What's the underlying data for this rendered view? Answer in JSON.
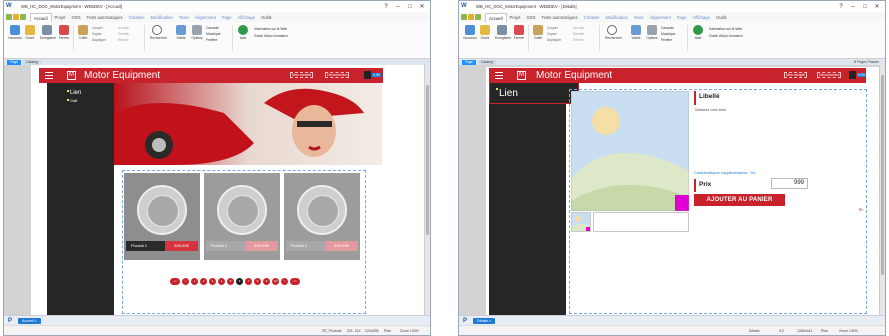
{
  "windowA": {
    "title": "WB_HC_DOC_MotorEquipment - WEBDEV - [Accueil]",
    "controls": [
      "?",
      "–",
      "□",
      "✕"
    ],
    "menu_tabs": [
      "Accueil",
      "Projet",
      "GDS",
      "Tests automatiques",
      "Création",
      "Modification",
      "Texte",
      "Alignement",
      "Page",
      "Affichage",
      "Outils"
    ],
    "ribbon": {
      "buttons": [
        "Nouveau",
        "Ouvrir",
        "Enregistrer",
        "Fermer",
        "Coller",
        "Rechercher",
        "Volets",
        "Options",
        "Aide"
      ],
      "clipboard": [
        "Couper",
        "Copier",
        "Dupliquer"
      ],
      "undo": [
        "Annuler",
        "Rétablir",
        "Refaire"
      ],
      "windows": [
        "Cascade",
        "Mosaïque",
        "Fenêtre"
      ],
      "help": [
        "Information sur le Web",
        "Guide d'Auto-formation"
      ],
      "groups": [
        "Général",
        "Presse-papiers",
        "Édition",
        "Rechercher",
        "Environnement",
        "Fenêtres",
        "Aide en ligne"
      ]
    },
    "editor_tabs": [
      "Page",
      "Catalog"
    ],
    "page": {
      "brand": "Motor Equipment",
      "header_links": [
        "Mon compte",
        "Déconnexion"
      ],
      "cart_badge": "0,00",
      "menu": [
        "Lien",
        "Outil"
      ],
      "products": [
        {
          "name": "Produit 1",
          "price": "539,00€"
        },
        {
          "name": "Produit 1",
          "price": "539,00€"
        },
        {
          "name": "Produit 1",
          "price": "539,00€"
        }
      ],
      "pager": [
        "<<",
        "<",
        "1",
        "2",
        "3",
        "4",
        "5",
        "6",
        "7",
        "8",
        "9",
        "10",
        ">",
        ">>"
      ],
      "pager_active": "6"
    },
    "bottom_tab": "Accueil ×",
    "status": [
      "ZR_Produits",
      "221, 314",
      "224x298",
      "Plan",
      "Zoom 100%"
    ]
  },
  "windowB": {
    "title": "WB_HC_DOC_MotorEquipment - WEBDEV - [Détails]",
    "controls": [
      "?",
      "–",
      "□",
      "✕"
    ],
    "menu_tabs": [
      "Accueil",
      "Projet",
      "GDS",
      "Tests automatiques",
      "Création",
      "Modification",
      "Texte",
      "Alignement",
      "Page",
      "Affichage",
      "Outils"
    ],
    "ribbon": {
      "buttons": [
        "Nouveau",
        "Ouvrir",
        "Enregistrer",
        "Fermer",
        "Coller",
        "Rechercher",
        "Volets",
        "Options",
        "Aide"
      ],
      "clipboard": [
        "Couper",
        "Copier",
        "Dupliquer"
      ],
      "undo": [
        "Annuler",
        "Rétablir",
        "Refaire"
      ],
      "windows": [
        "Cascade",
        "Mosaïque",
        "Fenêtre"
      ],
      "help": [
        "Information sur le Web",
        "Guide d'Auto-formation"
      ]
    },
    "editor_tabs": [
      "Page",
      "Catalog"
    ],
    "plans_label": "B  Pages Plasser",
    "page": {
      "brand": "Motor Equipment",
      "header_links": [
        "Mon compte",
        "Déconnexion"
      ],
      "cart_badge": "0,00",
      "menu_popup": "Lien",
      "libelle": "Libellé",
      "description": "Saisissez votre texte",
      "extra": "Caractéristiques supplémentaires : %1",
      "price_label": "Prix",
      "price_value": "999",
      "add_button": "AJOUTER AU PANIER"
    },
    "bottom_tab": "Détails ×",
    "status": [
      "Détails",
      "0,0",
      "1280x941",
      "Plan",
      "Zoom 100%"
    ]
  },
  "colors": {
    "brand_red": "#c8232c",
    "editor_blue": "#1e78d4"
  }
}
